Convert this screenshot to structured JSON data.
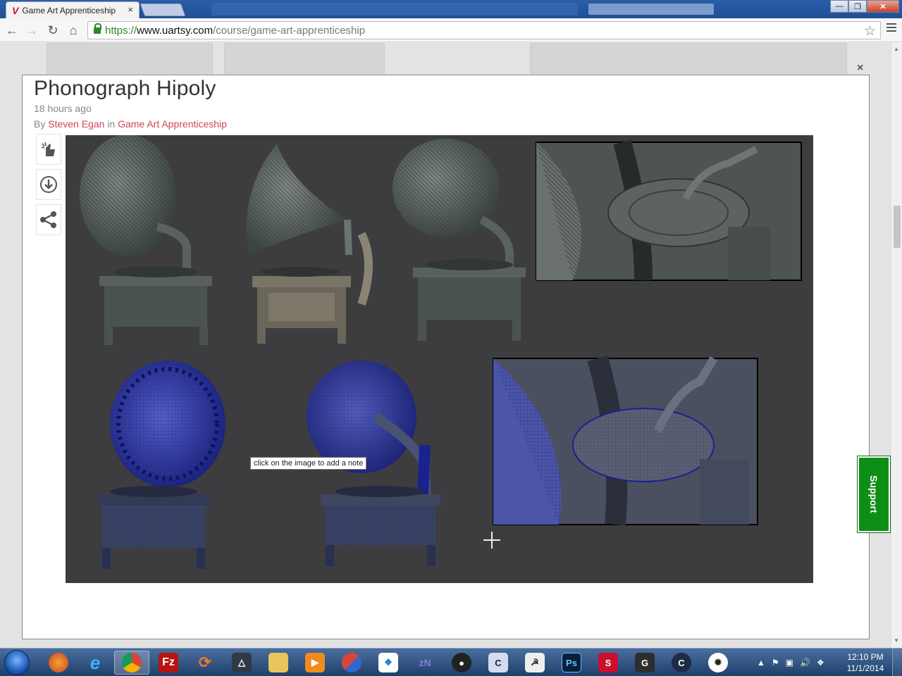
{
  "browser": {
    "tab_title": "Game Art Apprenticeship",
    "tab_close": "×",
    "url_scheme": "https://",
    "url_host": "www.uartsy.com",
    "url_path": "/course/game-art-apprenticeship"
  },
  "modal": {
    "close_label": "×",
    "title": "Phonograph Hipoly",
    "time": "18 hours ago",
    "by_prefix": "By",
    "author": "Steven Egan",
    "in_word": "in",
    "course": "Game Art Apprenticeship",
    "tooltip": "click on the image to add a note",
    "tools": [
      "like-icon",
      "download-icon",
      "share-icon"
    ]
  },
  "support_label": "Support",
  "taskbar": {
    "apps": [
      "firefox",
      "internet-explorer",
      "chrome",
      "filezilla",
      "autodesk",
      "unity",
      "file-explorer",
      "media-player",
      "crossover",
      "dropbox",
      "zbrush-n",
      "paint-tool",
      "cinema",
      "zbrush",
      "photoshop",
      "substance",
      "3ds-max",
      "cortana",
      "lightroom"
    ],
    "time": "12:10 PM",
    "date": "11/1/2014"
  },
  "colors": {
    "link": "#d0455a",
    "support": "#0f8e16",
    "artwork_bg": "#3d3d3f"
  }
}
